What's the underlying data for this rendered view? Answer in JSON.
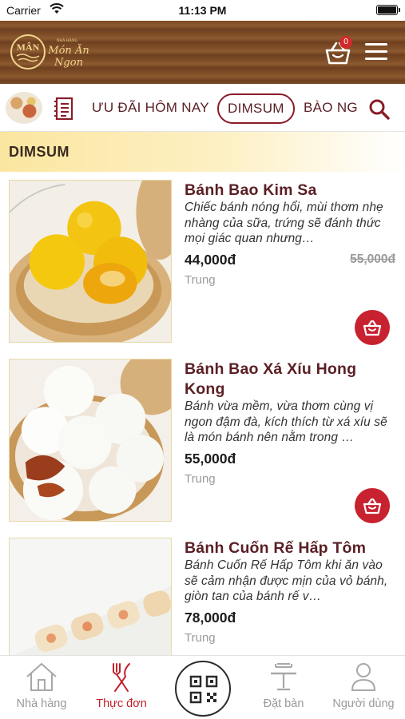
{
  "status_bar": {
    "carrier": "Carrier",
    "time": "11:13 PM"
  },
  "header": {
    "logo_text": "MÂN",
    "cart_count": "0",
    "colors": {
      "wood": "#7a4a24",
      "accent": "#c8212f",
      "brand": "#5a1f24"
    }
  },
  "tabs": {
    "items": [
      "ƯU ĐÃI HÔM NAY",
      "DIMSUM",
      "BÀO NG"
    ],
    "active": "DIMSUM"
  },
  "section": {
    "title": "DIMSUM"
  },
  "products": [
    {
      "name": "Bánh Bao Kim Sa",
      "description": "Chiếc bánh nóng hổi, mùi thơm nhẹ nhàng của sữa, trứng sẽ đánh thức mọi giác quan nhưng…",
      "price": "44,000đ",
      "old_price": "55,000đ",
      "size": "Trung"
    },
    {
      "name": "Bánh Bao Xá Xíu Hong Kong",
      "description": "Bánh vừa mềm, vừa thơm cùng vị ngon đậm đà, kích thích từ xá xíu sẽ là món bánh nên nằm trong …",
      "price": "55,000đ",
      "old_price": "",
      "size": "Trung"
    },
    {
      "name": "Bánh Cuốn Rế Hấp Tôm",
      "description": "Bánh Cuốn Rế Hấp Tôm khi ăn vào sẽ cảm nhận được mịn của vỏ bánh, giòn tan của bánh rế v…",
      "price": "78,000đ",
      "old_price": "",
      "size": "Trung"
    }
  ],
  "bottom_nav": {
    "items": [
      "Nhà hàng",
      "Thực đơn",
      "Đặt bàn",
      "Người dùng"
    ],
    "active": "Thực đơn"
  }
}
